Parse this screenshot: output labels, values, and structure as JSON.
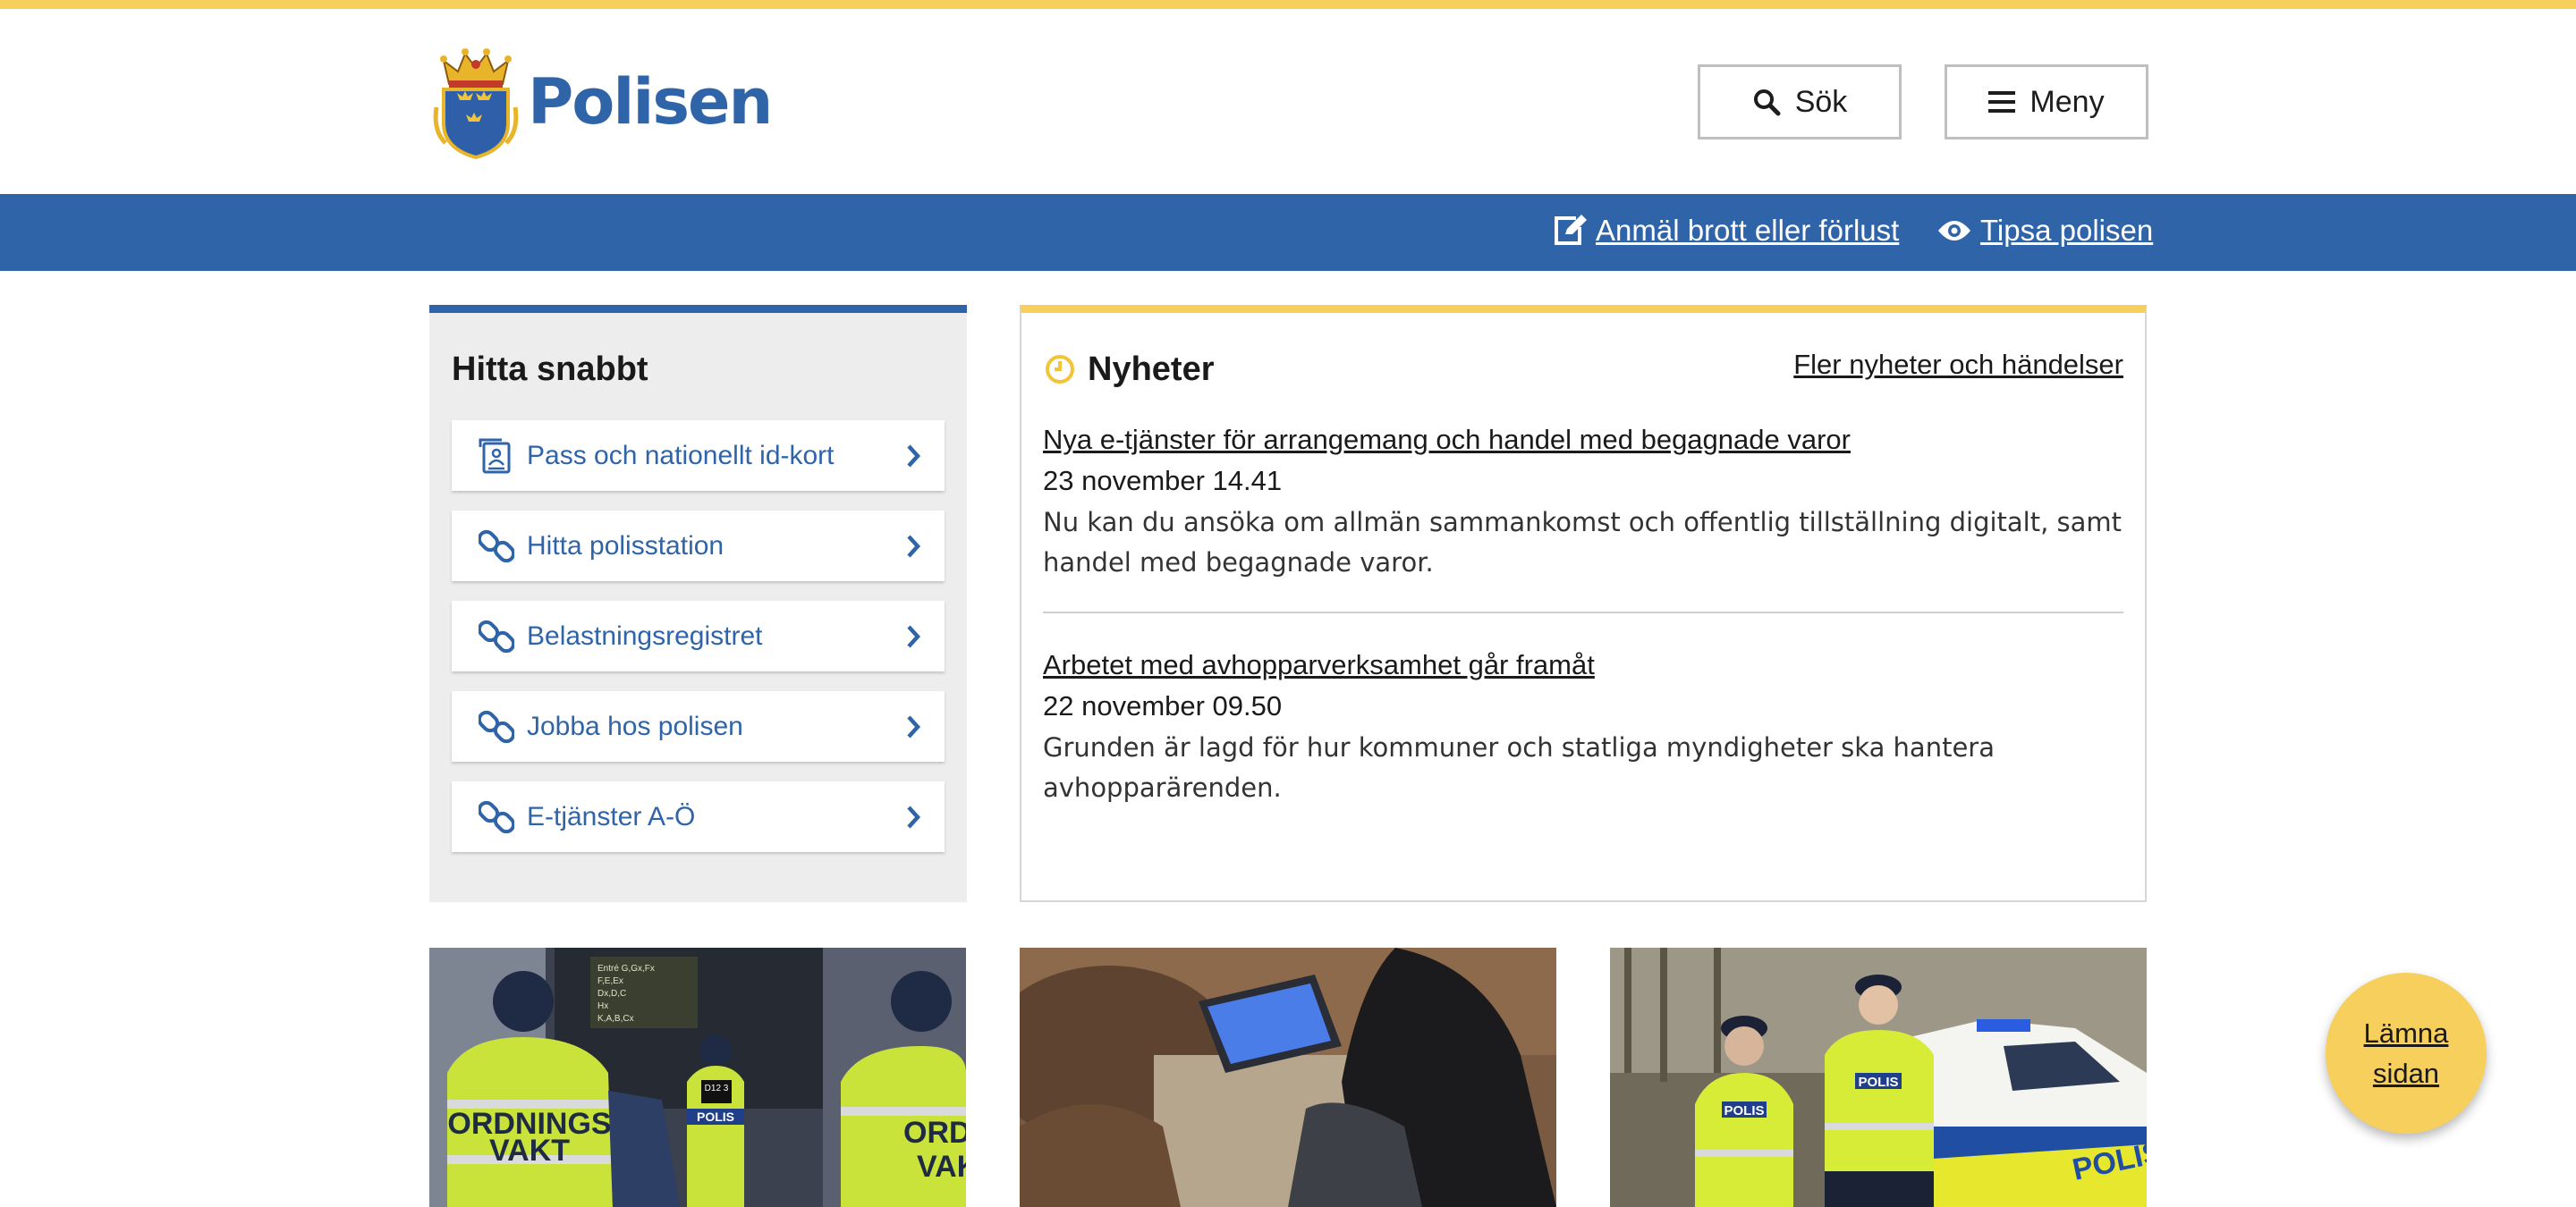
{
  "header": {
    "logo_text": "Polisen",
    "search_label": "Sök",
    "menu_label": "Meny"
  },
  "bluebar": {
    "report_label": "Anmäl brott eller förlust",
    "tip_label": "Tipsa polisen"
  },
  "quick_find": {
    "title": "Hitta snabbt",
    "items": [
      {
        "label": "Pass och nationellt id-kort",
        "icon": "id-card-icon"
      },
      {
        "label": "Hitta polisstation",
        "icon": "link-icon"
      },
      {
        "label": "Belastningsregistret",
        "icon": "link-icon"
      },
      {
        "label": "Jobba hos polisen",
        "icon": "link-icon"
      },
      {
        "label": "E-tjänster A-Ö",
        "icon": "link-icon"
      }
    ]
  },
  "news": {
    "title": "Nyheter",
    "more_link": "Fler nyheter och händelser",
    "articles": [
      {
        "title": "Nya e-tjänster för arrangemang och handel med begagnade varor",
        "date": "23 november 14.41",
        "summary": "Nu kan du ansöka om allmän sammankomst och offentlig tillställning digitalt, samt handel med begagnade varor."
      },
      {
        "title": "Arbetet med avhopparverksamhet går framåt",
        "date": "22 november 09.50",
        "summary": "Grunden är lagd för hur kommuner och statliga myndigheter ska hantera avhopparärenden."
      }
    ]
  },
  "cards": {
    "card1": {
      "vest1": "ORDNINGS",
      "vest1b": "VAKT",
      "vest2": "POLIS",
      "vest3": "ORDNI",
      "vest3b": "VAK",
      "badge": "D12 3"
    },
    "card3": {
      "vest1": "POLIS",
      "vest2": "POLIS",
      "car": "POLIS"
    }
  },
  "leave_button": {
    "label": "Lämna sidan"
  },
  "colors": {
    "brand_blue": "#2f64a9",
    "accent_yellow": "#f6cf5c",
    "panel_grey": "#ededed"
  }
}
